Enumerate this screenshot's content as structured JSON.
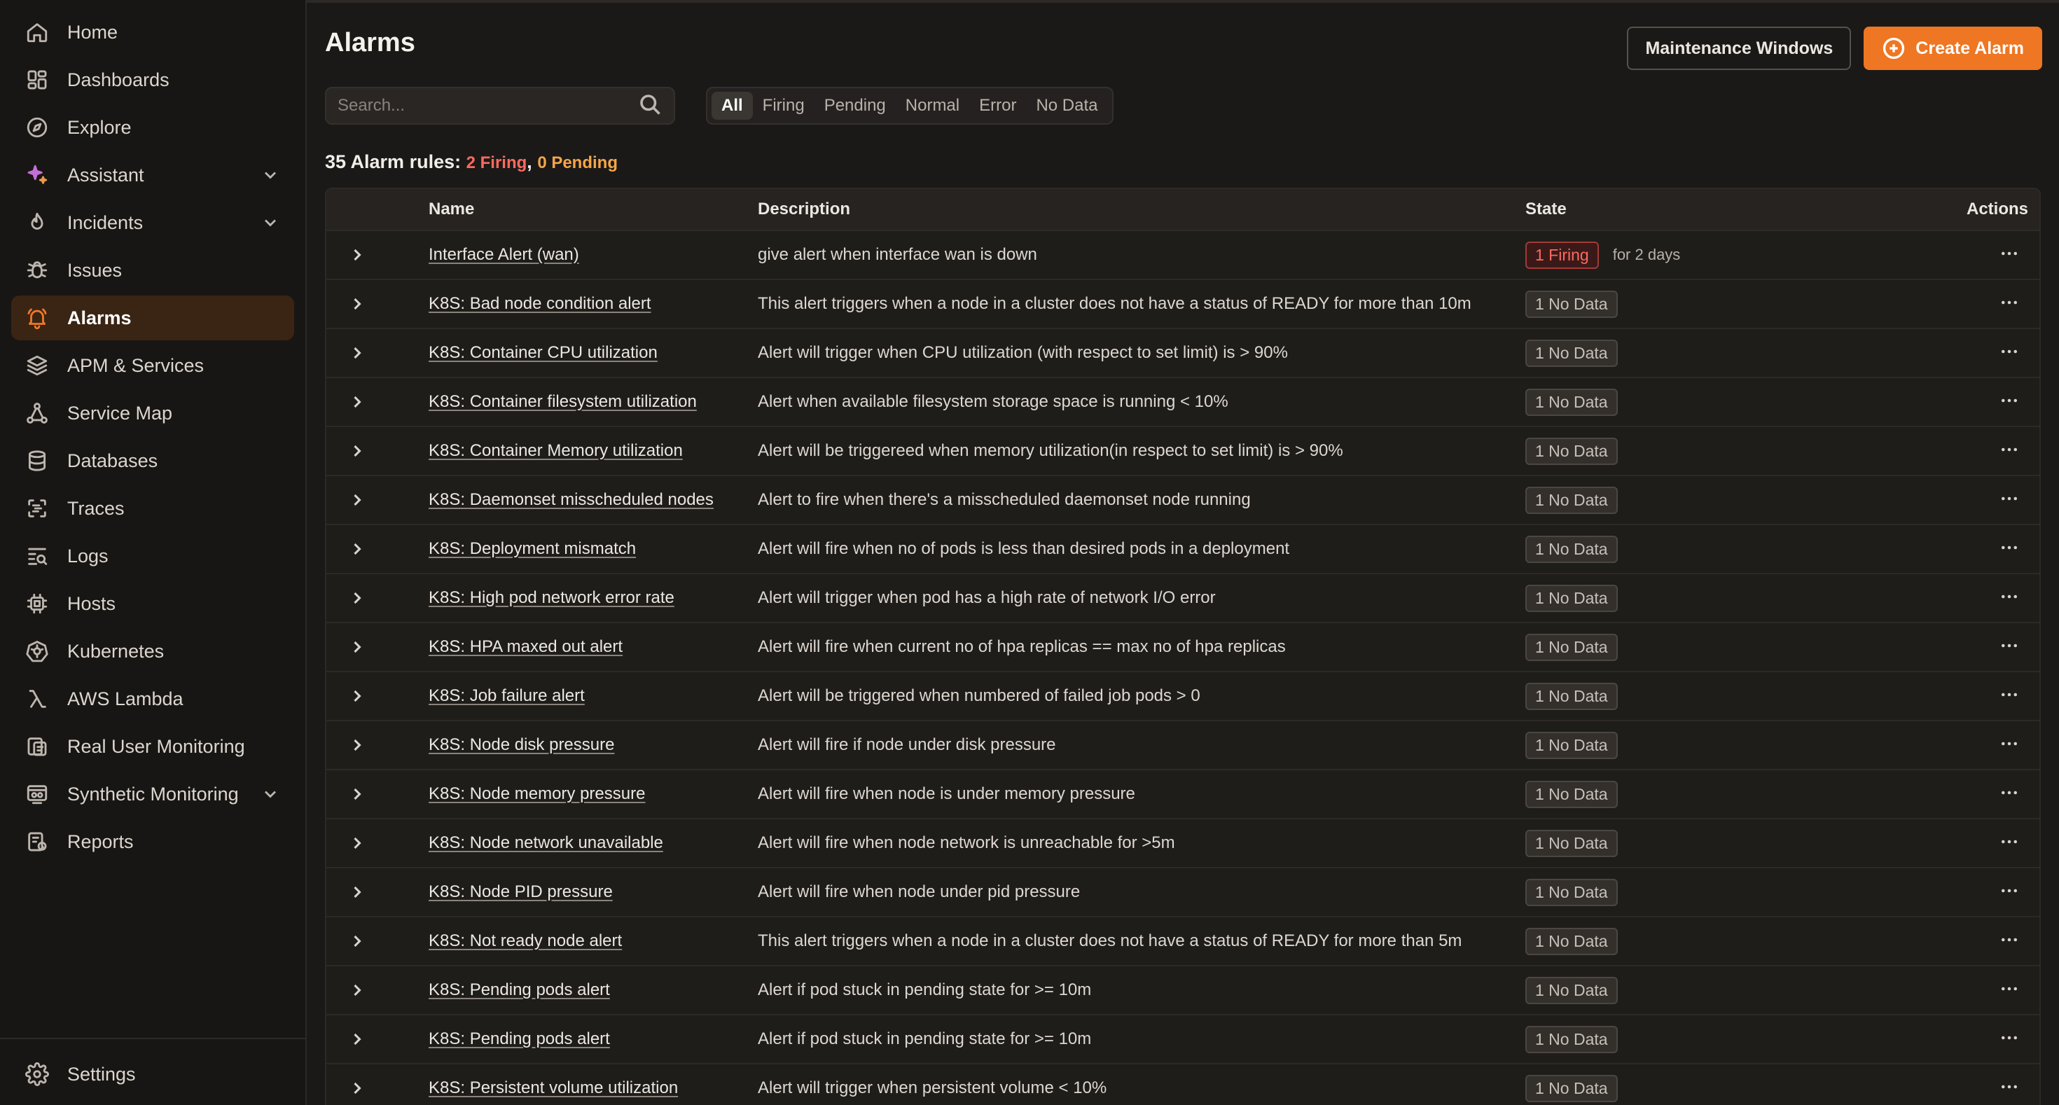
{
  "sidebar": {
    "items": [
      {
        "label": "Home",
        "icon": "home-icon",
        "active": false,
        "expandable": false
      },
      {
        "label": "Dashboards",
        "icon": "dashboard-icon",
        "active": false,
        "expandable": false
      },
      {
        "label": "Explore",
        "icon": "compass-icon",
        "active": false,
        "expandable": false
      },
      {
        "label": "Assistant",
        "icon": "sparkle-icon",
        "active": false,
        "expandable": true
      },
      {
        "label": "Incidents",
        "icon": "flame-icon",
        "active": false,
        "expandable": true
      },
      {
        "label": "Issues",
        "icon": "bug-icon",
        "active": false,
        "expandable": false
      },
      {
        "label": "Alarms",
        "icon": "bell-icon",
        "active": true,
        "expandable": false
      },
      {
        "label": "APM & Services",
        "icon": "layers-icon",
        "active": false,
        "expandable": false
      },
      {
        "label": "Service Map",
        "icon": "service-map-icon",
        "active": false,
        "expandable": false
      },
      {
        "label": "Databases",
        "icon": "database-icon",
        "active": false,
        "expandable": false
      },
      {
        "label": "Traces",
        "icon": "traces-icon",
        "active": false,
        "expandable": false
      },
      {
        "label": "Logs",
        "icon": "logs-icon",
        "active": false,
        "expandable": false
      },
      {
        "label": "Hosts",
        "icon": "chip-icon",
        "active": false,
        "expandable": false
      },
      {
        "label": "Kubernetes",
        "icon": "kubernetes-icon",
        "active": false,
        "expandable": false
      },
      {
        "label": "AWS Lambda",
        "icon": "lambda-icon",
        "active": false,
        "expandable": false
      },
      {
        "label": "Real User Monitoring",
        "icon": "rum-icon",
        "active": false,
        "expandable": false
      },
      {
        "label": "Synthetic Monitoring",
        "icon": "synthetic-icon",
        "active": false,
        "expandable": true
      },
      {
        "label": "Reports",
        "icon": "reports-icon",
        "active": false,
        "expandable": false
      }
    ],
    "settings_label": "Settings"
  },
  "header": {
    "title": "Alarms",
    "maintenance_label": "Maintenance Windows",
    "create_label": "Create Alarm"
  },
  "search": {
    "placeholder": "Search..."
  },
  "filters": [
    {
      "label": "All",
      "active": true
    },
    {
      "label": "Firing",
      "active": false
    },
    {
      "label": "Pending",
      "active": false
    },
    {
      "label": "Normal",
      "active": false
    },
    {
      "label": "Error",
      "active": false
    },
    {
      "label": "No Data",
      "active": false
    }
  ],
  "summary": {
    "prefix": "35 Alarm rules:",
    "firing": "2 Firing",
    "separator": ",",
    "pending": "0 Pending"
  },
  "table": {
    "columns": {
      "name": "Name",
      "description": "Description",
      "state": "State",
      "actions": "Actions"
    },
    "rows": [
      {
        "name": "Interface Alert (wan)",
        "description": "give alert when interface wan is down",
        "state": "1 Firing",
        "state_type": "firing",
        "duration": "for 2 days"
      },
      {
        "name": "K8S: Bad node condition alert",
        "description": "This alert triggers when a node in a cluster does not have a status of READY for more than 10m",
        "state": "1 No Data",
        "state_type": "nodata",
        "duration": ""
      },
      {
        "name": "K8S: Container CPU utilization",
        "description": "Alert will trigger when CPU utilization (with respect to set limit) is > 90%",
        "state": "1 No Data",
        "state_type": "nodata",
        "duration": ""
      },
      {
        "name": "K8S: Container filesystem utilization",
        "description": "Alert when available filesystem storage space is running < 10%",
        "state": "1 No Data",
        "state_type": "nodata",
        "duration": ""
      },
      {
        "name": "K8S: Container Memory utilization",
        "description": "Alert will be triggereed when memory utilization(in respect to set limit) is > 90%",
        "state": "1 No Data",
        "state_type": "nodata",
        "duration": ""
      },
      {
        "name": "K8S: Daemonset misscheduled nodes",
        "description": "Alert to fire when there's a misscheduled daemonset node running",
        "state": "1 No Data",
        "state_type": "nodata",
        "duration": ""
      },
      {
        "name": "K8S: Deployment mismatch",
        "description": "Alert will fire when no of pods is less than desired pods in a deployment",
        "state": "1 No Data",
        "state_type": "nodata",
        "duration": ""
      },
      {
        "name": "K8S: High pod network error rate",
        "description": "Alert will trigger when pod has a high rate of network I/O error",
        "state": "1 No Data",
        "state_type": "nodata",
        "duration": ""
      },
      {
        "name": "K8S: HPA maxed out alert",
        "description": "Alert will fire when current no of hpa replicas == max no of hpa replicas",
        "state": "1 No Data",
        "state_type": "nodata",
        "duration": ""
      },
      {
        "name": "K8S: Job failure alert",
        "description": "Alert will be triggered when numbered of failed job pods > 0",
        "state": "1 No Data",
        "state_type": "nodata",
        "duration": ""
      },
      {
        "name": "K8S: Node disk pressure",
        "description": "Alert will fire if node under disk pressure",
        "state": "1 No Data",
        "state_type": "nodata",
        "duration": ""
      },
      {
        "name": "K8S: Node memory pressure",
        "description": "Alert will fire when node is under memory pressure",
        "state": "1 No Data",
        "state_type": "nodata",
        "duration": ""
      },
      {
        "name": "K8S: Node network unavailable",
        "description": "Alert will fire when node network is unreachable for >5m",
        "state": "1 No Data",
        "state_type": "nodata",
        "duration": ""
      },
      {
        "name": "K8S: Node PID pressure",
        "description": "Alert will fire when node under pid pressure",
        "state": "1 No Data",
        "state_type": "nodata",
        "duration": ""
      },
      {
        "name": "K8S: Not ready node alert",
        "description": "This alert triggers when a node in a cluster does not have a status of READY for more than 5m",
        "state": "1 No Data",
        "state_type": "nodata",
        "duration": ""
      },
      {
        "name": "K8S: Pending pods alert",
        "description": "Alert if pod stuck in pending state for >= 10m",
        "state": "1 No Data",
        "state_type": "nodata",
        "duration": ""
      },
      {
        "name": "K8S: Pending pods alert",
        "description": "Alert if pod stuck in pending state for >= 10m",
        "state": "1 No Data",
        "state_type": "nodata",
        "duration": ""
      },
      {
        "name": "K8S: Persistent volume utilization",
        "description": "Alert will trigger when persistent volume < 10%",
        "state": "1 No Data",
        "state_type": "nodata",
        "duration": ""
      }
    ]
  }
}
